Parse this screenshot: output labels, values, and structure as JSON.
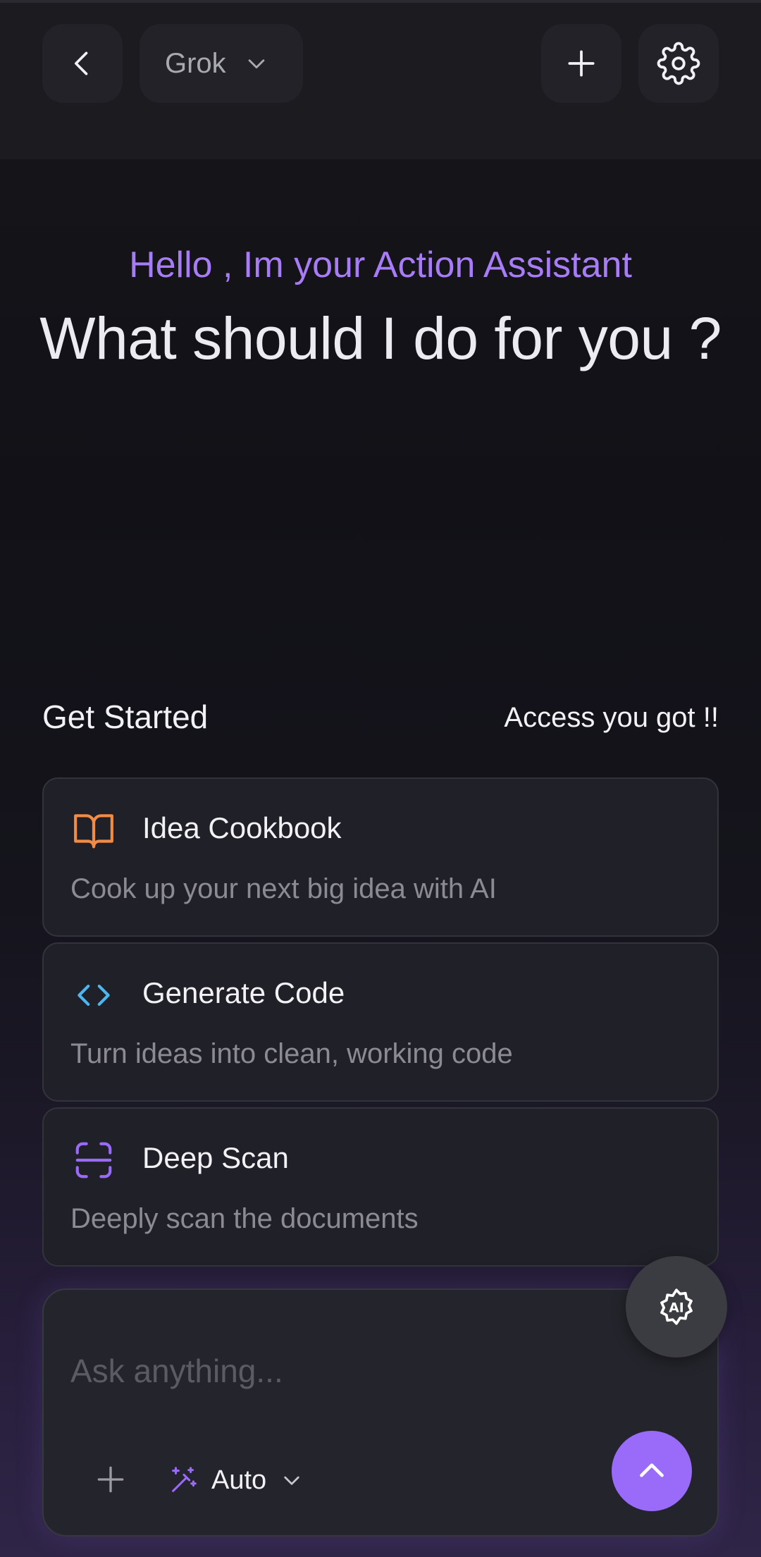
{
  "header": {
    "model_label": "Grok"
  },
  "hero": {
    "greeting": "Hello , Im your Action Assistant",
    "title": "What should I do for you ?"
  },
  "section": {
    "title": "Get Started",
    "note": "Access you got !!"
  },
  "cards": [
    {
      "title": "Idea Cookbook",
      "description": "Cook up your next big idea with AI",
      "icon": "book-icon",
      "icon_color": "#f28c45"
    },
    {
      "title": "Generate Code",
      "description": "Turn ideas into clean, working code",
      "icon": "code-icon",
      "icon_color": "#4bb6f0"
    },
    {
      "title": "Deep Scan",
      "description": "Deeply scan the documents",
      "icon": "scan-icon",
      "icon_color": "#9a6af8"
    }
  ],
  "composer": {
    "placeholder": "Ask anything...",
    "mode_label": "Auto"
  },
  "fab": {
    "icon": "ai-sparkle-icon"
  },
  "colors": {
    "accent": "#9a6af8",
    "greeting": "#a77cf6",
    "background": "#111117"
  }
}
